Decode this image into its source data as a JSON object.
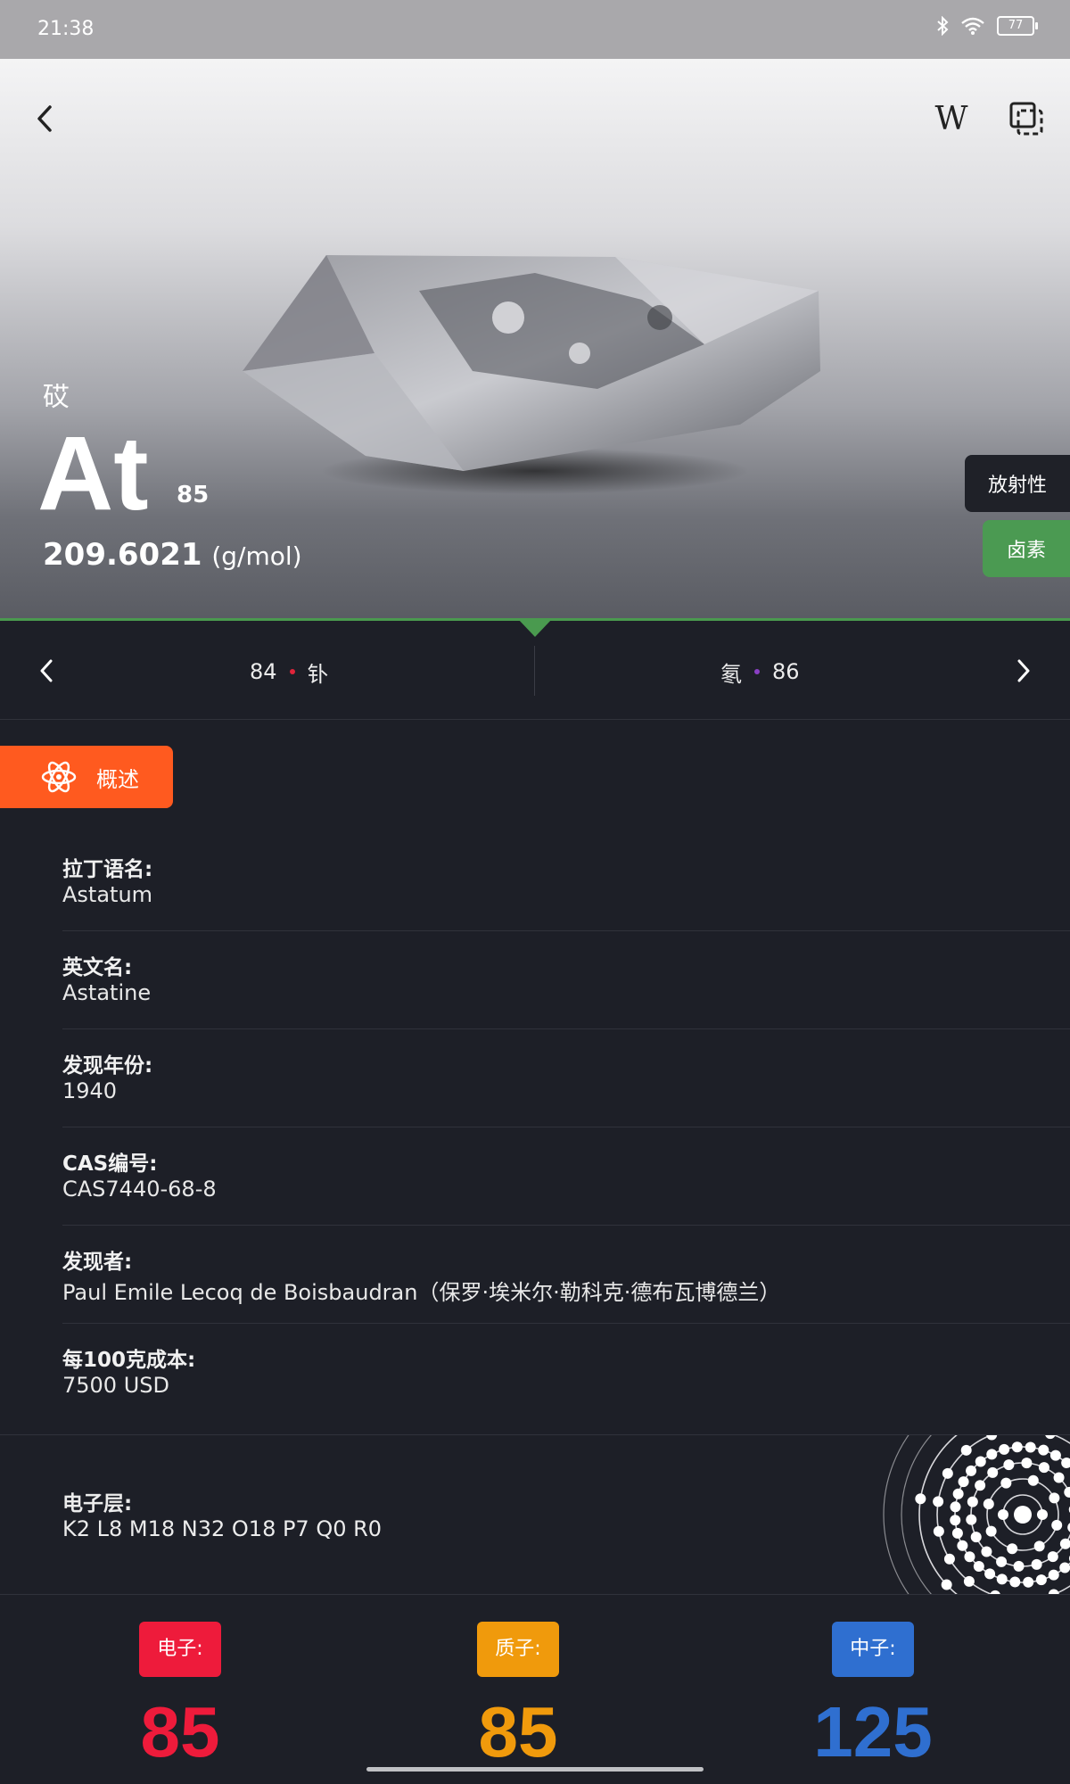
{
  "status_bar": {
    "time": "21:38",
    "battery": "77"
  },
  "element": {
    "chinese_name": "砹",
    "symbol": "At",
    "atomic_number": "85",
    "atomic_mass": "209.6021",
    "mass_unit": "(g/mol)",
    "tags": [
      "放射性",
      "卤素"
    ]
  },
  "toolbar": {
    "wiki_label": "W"
  },
  "navigation": {
    "prev": {
      "number": "84",
      "name": "钋",
      "dot_color": "#e0243a"
    },
    "next": {
      "number": "86",
      "name": "氡",
      "dot_color": "#8a3fc4"
    }
  },
  "overview_tab": {
    "label": "概述"
  },
  "info": [
    {
      "label": "拉丁语名:",
      "value": "Astatum"
    },
    {
      "label": "英文名:",
      "value": "Astatine"
    },
    {
      "label": "发现年份:",
      "value": "1940"
    },
    {
      "label": "CAS编号:",
      "value": "CAS7440-68-8"
    },
    {
      "label": "发现者:",
      "value": "Paul Emile Lecoq de Boisbaudran（保罗·埃米尔·勒科克·德布瓦博德兰）"
    },
    {
      "label": "每100克成本:",
      "value": "7500 USD"
    }
  ],
  "electron_shells": {
    "label": "电子层:",
    "value": "K2 L8 M18 N32 O18 P7 Q0 R0"
  },
  "counts": [
    {
      "label": "电子:",
      "value": "85",
      "color": "#ee1b3b"
    },
    {
      "label": "质子:",
      "value": "85",
      "color": "#f09a0c"
    },
    {
      "label": "中子:",
      "value": "125",
      "color": "#2f6fd0"
    }
  ]
}
